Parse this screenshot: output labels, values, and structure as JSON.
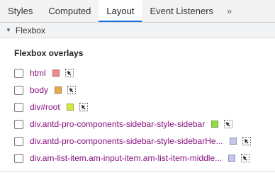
{
  "tabs": {
    "items": [
      {
        "label": "Styles",
        "active": false
      },
      {
        "label": "Computed",
        "active": false
      },
      {
        "label": "Layout",
        "active": true
      },
      {
        "label": "Event Listeners",
        "active": false
      }
    ],
    "more_label": "»"
  },
  "section": {
    "title": "Flexbox",
    "expanded": true
  },
  "overlays": {
    "title": "Flexbox overlays",
    "items": [
      {
        "label": "html",
        "checked": false,
        "color": "#ee8a8a"
      },
      {
        "label": "body",
        "checked": false,
        "color": "#e3aa50"
      },
      {
        "label": "div#root",
        "checked": false,
        "color": "#d6e744"
      },
      {
        "label": "div.antd-pro-components-sidebar-style-sidebar",
        "checked": false,
        "color": "#95da48"
      },
      {
        "label": "div.antd-pro-components-sidebar-style-sidebarHe...",
        "checked": false,
        "color": "#c5c6ee"
      },
      {
        "label": "div.am-list-item.am-input-item.am-list-item-middle...",
        "checked": false,
        "color": "#c5c6ee"
      }
    ]
  },
  "icons": {
    "reveal": "reveal-node-icon",
    "checkbox": "checkbox"
  }
}
